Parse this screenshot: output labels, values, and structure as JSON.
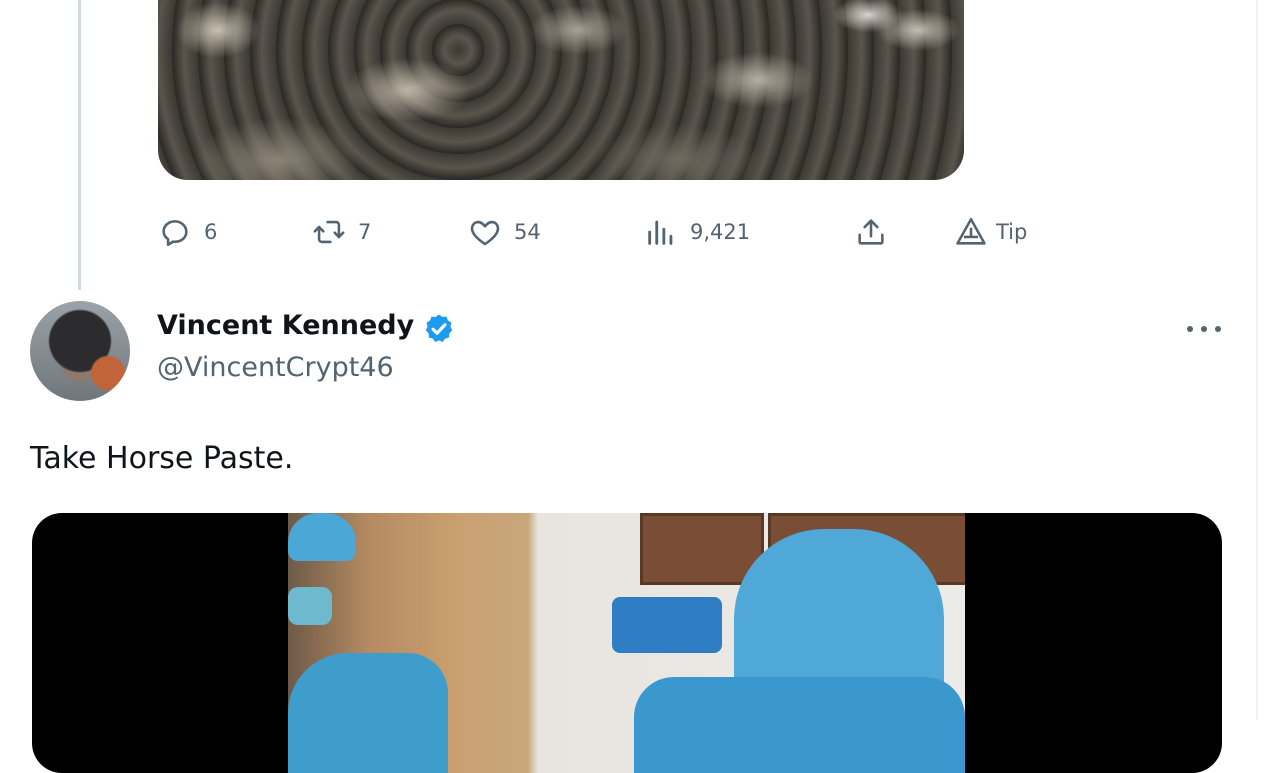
{
  "previous_tweet": {
    "actions": {
      "reply_count": "6",
      "retweet_count": "7",
      "like_count": "54",
      "view_count": "9,421",
      "tip_label": "Tip"
    }
  },
  "tweet": {
    "author_name": "Vincent Kennedy",
    "author_handle": "@VincentCrypt46",
    "text": "Take Horse Paste."
  },
  "colors": {
    "verified_blue": "#1d9bf0",
    "secondary_text": "#536471",
    "thread_line": "#cfd9de"
  },
  "icons": [
    "reply-icon",
    "retweet-icon",
    "like-icon",
    "views-icon",
    "share-icon",
    "tip-icon",
    "verified-icon",
    "more-icon"
  ]
}
